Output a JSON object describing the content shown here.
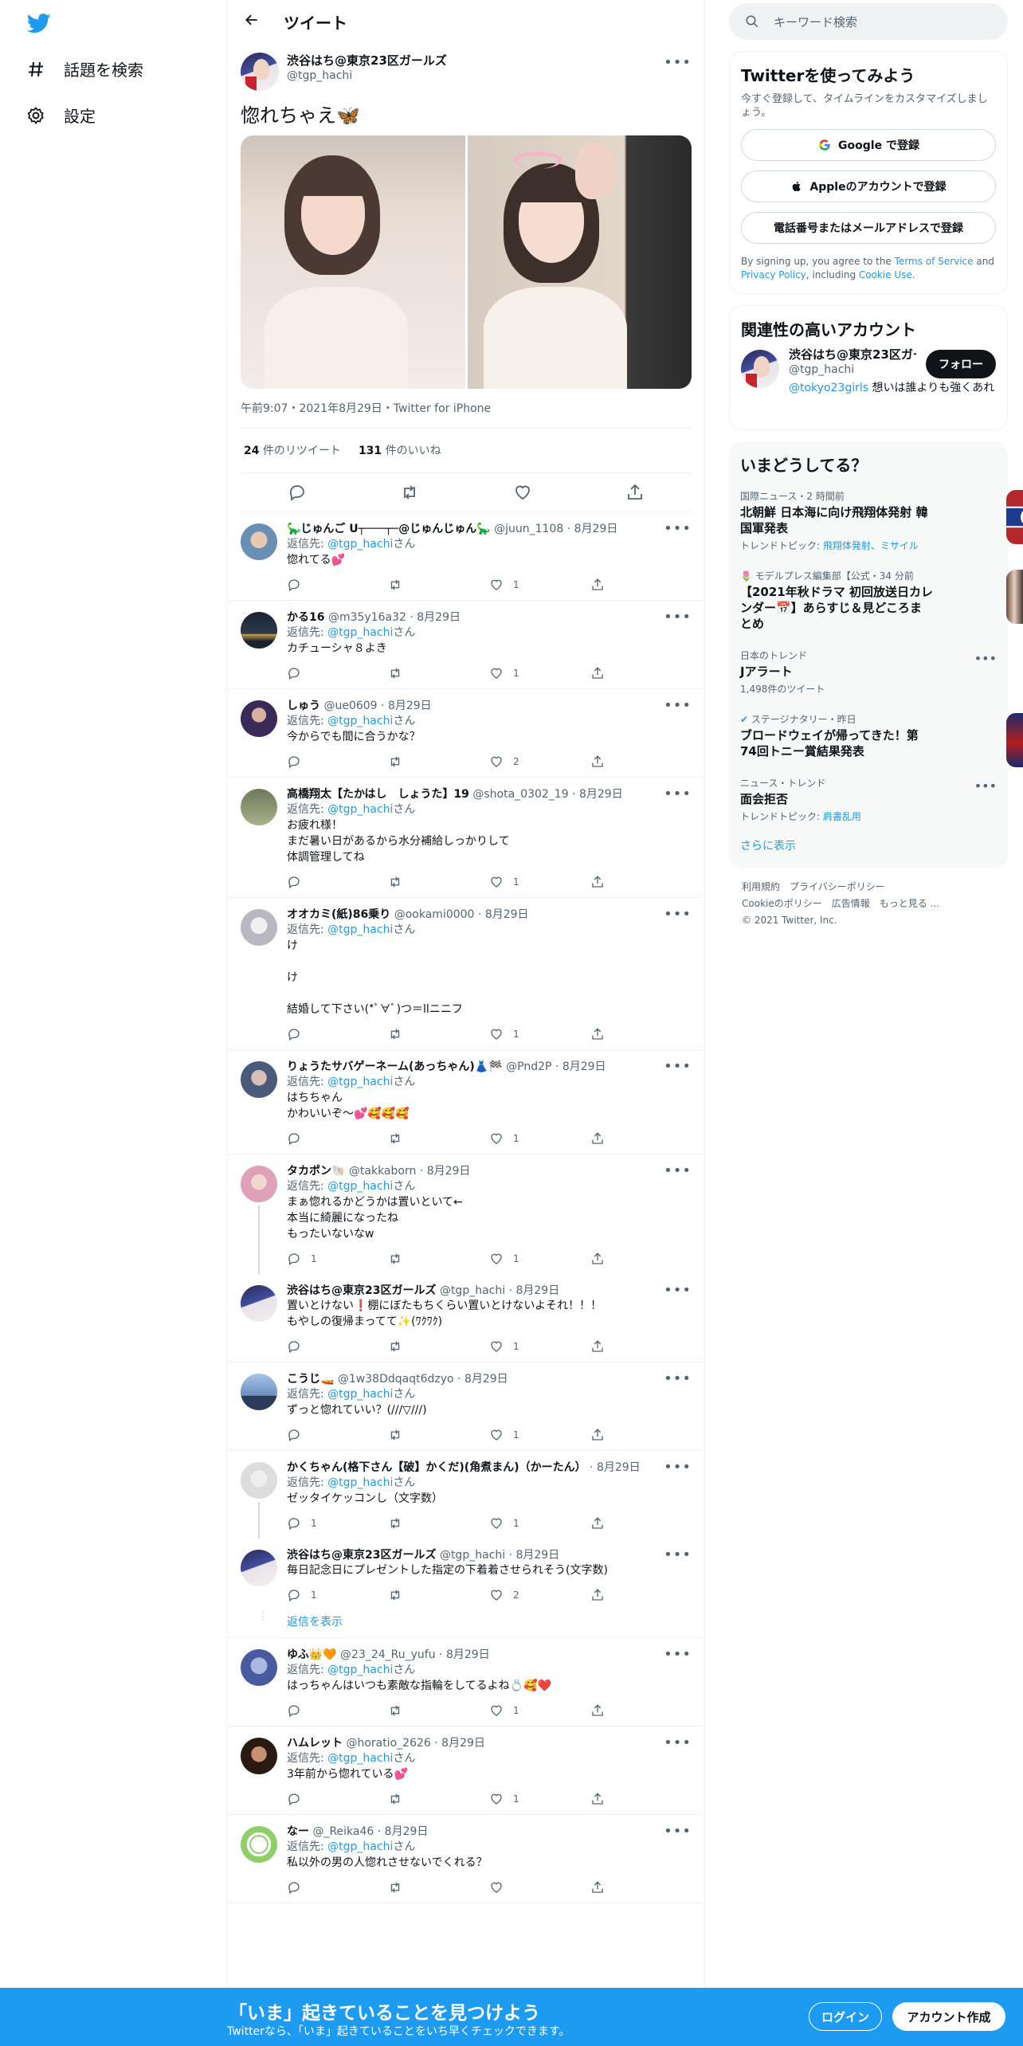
{
  "nav": {
    "explore": "話題を検索",
    "settings": "設定"
  },
  "header": {
    "title": "ツイート"
  },
  "tweet": {
    "name": "渋谷はち@東京23区ガールズ",
    "handle": "@tgp_hachi",
    "text": "惚れちゃえ🦋",
    "meta": "午前9:07・2021年8月29日・Twitter for iPhone",
    "retweets": "24",
    "retweets_label": " 件のリツイート",
    "likes": "131",
    "likes_label": " 件のいいね"
  },
  "reply_prefix": "返信先: ",
  "reply_to": "@tgp_hachi",
  "reply_suffix": "さん",
  "show_replies": "返信を表示",
  "replies": [
    {
      "name": "🦕じゅんご ᑌ┬───┬─@じゅんじゅん🦕",
      "handle": "@juun_1108",
      "date": "8月29日",
      "to": true,
      "text": "惚れてる💕",
      "reply": "",
      "like": "1"
    },
    {
      "name": "かる16",
      "handle": "@m35y16a32",
      "date": "8月29日",
      "to": true,
      "text": "カチューシャ８よき",
      "reply": "",
      "like": "1"
    },
    {
      "name": "しゅう",
      "handle": "@ue0609",
      "date": "8月29日",
      "to": true,
      "text": "今からでも間に合うかな？",
      "reply": "",
      "like": "2"
    },
    {
      "name": "高橋翔太【たかはし　しょうた】19",
      "handle": "@shota_0302_19",
      "date": "8月29日",
      "to": true,
      "text": "お疲れ様！\nまだ暑い日があるから水分補給しっかりして\n体調管理してね",
      "reply": "",
      "like": "1"
    },
    {
      "name": "オオカミ(紙)86乗り",
      "handle": "@ookami0000",
      "date": "8月29日",
      "to": true,
      "text": "け\n\nけ\n\n結婚して下さい(*ﾟ∀ﾟ)つ＝llニニフ",
      "reply": "",
      "like": "1"
    },
    {
      "name": "りょうたサバゲーネーム(あっちゃん)👗🏁",
      "handle": "@Pnd2P",
      "date": "8月29日",
      "to": true,
      "text": "はちちゃん\nかわいいぞ〜💕🥰🥰🥰",
      "reply": "",
      "like": "1"
    },
    {
      "name": "タカポン🐚",
      "handle": "@takkaborn",
      "date": "8月29日",
      "to": true,
      "text": "まぁ惚れるかどうかは置いといて←\n本当に綺麗になったね\nもったいないなw",
      "reply": "1",
      "like": "1",
      "chain": true
    },
    {
      "name": "渋谷はち@東京23区ガールズ",
      "handle": "@tgp_hachi",
      "date": "8月29日",
      "to": false,
      "text": "置いとけない❗️棚にぼたもちくらい置いとけないよそれ！！！\nもやしの復帰まってて✨(ﾜｸﾜｸ)",
      "reply": "",
      "like": "1"
    },
    {
      "name": "こうじ🚤",
      "handle": "@1w38Ddqaqt6dzyo",
      "date": "8月29日",
      "to": true,
      "text": "ずっと惚れていい？(///▽///)",
      "reply": "",
      "like": "1"
    },
    {
      "name": "かくちゃん(格下さん【破】かくだ)(角煮まん)（かーたん）",
      "handle": "",
      "date": "8月29日",
      "to": true,
      "text": "ゼッタイケッコンし（文字数）",
      "reply": "1",
      "like": "1",
      "chain": true
    },
    {
      "name": "渋谷はち@東京23区ガールズ",
      "handle": "@tgp_hachi",
      "date": "8月29日",
      "to": false,
      "text": "毎日記念日にプレゼントした指定の下着着させられそう(文字数)",
      "reply": "1",
      "like": "2",
      "showmore": true
    },
    {
      "name": "ゆふ👑🧡",
      "handle": "@23_24_Ru_yufu",
      "date": "8月29日",
      "to": true,
      "text": "はっちゃんはいつも素敵な指輪をしてるよね💍🥰❤️",
      "reply": "",
      "like": "1"
    },
    {
      "name": "ハムレット",
      "handle": "@horatio_2626",
      "date": "8月29日",
      "to": true,
      "text": "3年前から惚れている💕",
      "reply": "",
      "like": "1"
    },
    {
      "name": "なー",
      "handle": "@_Reika46",
      "date": "8月29日",
      "to": true,
      "text": "私以外の男の人惚れさせないでくれる？",
      "reply": "",
      "like": ""
    }
  ],
  "search": {
    "placeholder": "キーワード検索"
  },
  "signup": {
    "title": "Twitterを使ってみよう",
    "sub": "今すぐ登録して、タイムラインをカスタマイズしましょう。",
    "google": "Google で登録",
    "apple": "Appleのアカウントで登録",
    "phone": "電話番号またはメールアドレスで登録",
    "terms1": "By signing up, you agree to the ",
    "tos": "Terms of Service",
    "and": " and ",
    "privacy": "Privacy Policy",
    "including": ", including ",
    "cookie": "Cookie Use",
    "period": "."
  },
  "related": {
    "title": "関連性の高いアカウント",
    "name": "渋谷はち@東京23区ガー",
    "handle": "@tgp_hachi",
    "follow": "フォロー",
    "bio_link": "@tokyo23girls",
    "bio": " 想いは誰よりも強くあれ"
  },
  "trends": {
    "title": "いまどうしてる？",
    "items": [
      {
        "cat": "国際ニュース・2 時間前",
        "title": "北朝鮮 日本海に向け飛翔体発射 韓国軍発表",
        "sub_label": "トレンドトピック: ",
        "sub": "飛翔体発射、ミサイル"
      },
      {
        "cat": "🌷 モデルプレス編集部【公式・34 分前",
        "title": "【2021年秋ドラマ 初回放送日カレンダー📅】あらすじ＆見どころまとめ",
        "sub_label": "",
        "sub": ""
      },
      {
        "cat": "日本のトレンド",
        "title": "Jアラート",
        "sub_label": "1,498件のツイート",
        "sub": ""
      },
      {
        "cat": "ステージナタリー・昨日",
        "title": "ブロードウェイが帰ってきた！第74回トニー賞結果発表",
        "sub_label": "",
        "sub": ""
      },
      {
        "cat": "ニュース・トレンド",
        "title": "面会拒否",
        "sub_label": "トレンドトピック: ",
        "sub": "肩書乱用"
      }
    ],
    "more": "さらに表示"
  },
  "footer": {
    "l1": "利用規約　プライバシーポリシー",
    "l2": "Cookieのポリシー　広告情報　もっと見る ...",
    "l3": "© 2021 Twitter, Inc."
  },
  "bottom": {
    "title": "「いま」起きていることを見つけよう",
    "sub": "Twitterなら、「いま」起きていることをいち早くチェックできます。",
    "login": "ログイン",
    "signup": "アカウント作成"
  },
  "colors": {
    "accent": "#1d9bf0",
    "text": "#0f1419",
    "muted": "#536471"
  }
}
